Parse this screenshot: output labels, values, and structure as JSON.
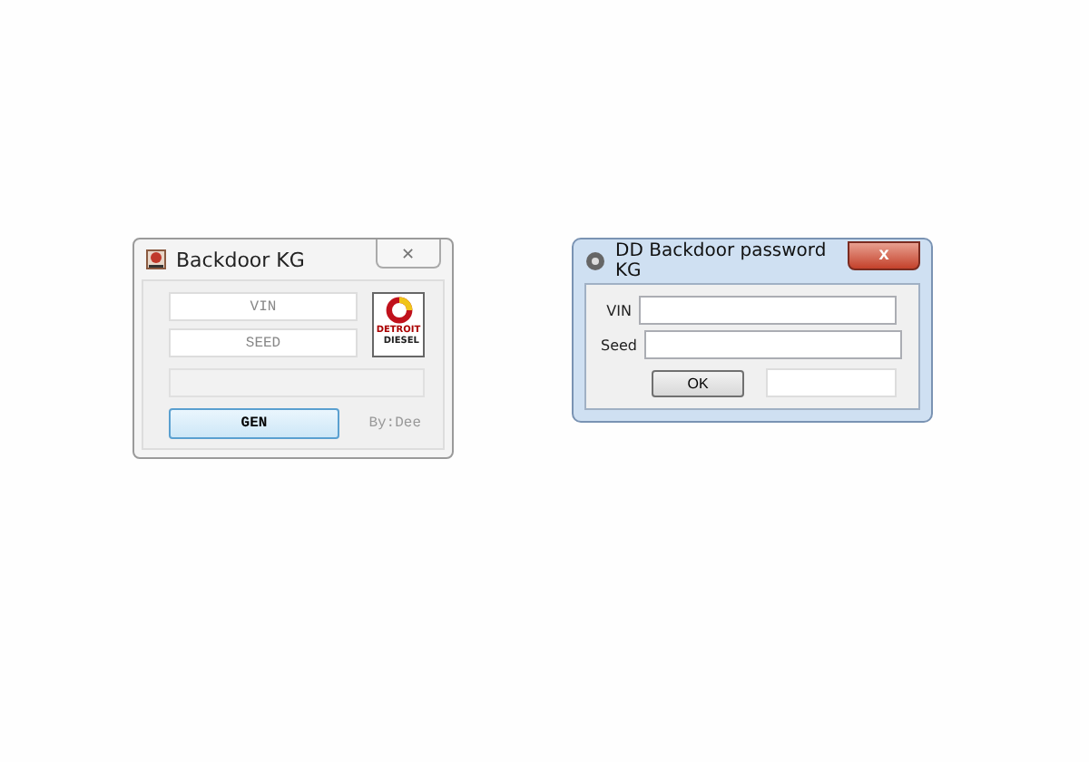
{
  "windows": [
    {
      "kind": "basic",
      "title": "Backdoor KG",
      "close": "✕",
      "fields": [
        {
          "placeholder": "VIN"
        },
        {
          "placeholder": "SEED"
        }
      ],
      "logo": {
        "line_1": "DETROIT",
        "line_2": "DIESEL"
      },
      "button": "GEN",
      "credit": "By:Dee"
    },
    {
      "kind": "aero",
      "title": "DD Backdoor password KG",
      "close": "x",
      "fields": [
        {
          "label": "VIN"
        },
        {
          "label": "Seed"
        }
      ],
      "button": "OK"
    }
  ]
}
